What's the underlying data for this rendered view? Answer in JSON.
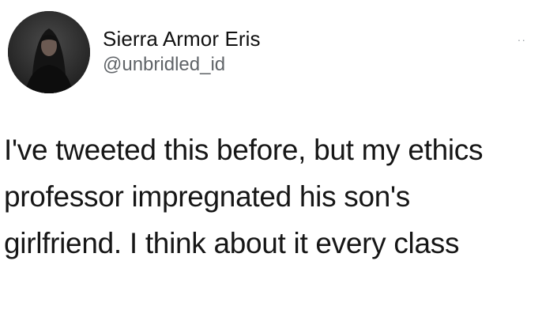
{
  "user": {
    "display_name": "Sierra Armor Eris",
    "handle": "@unbridled_id",
    "avatar": "profile-photo"
  },
  "menu_icon": "more-dots-icon",
  "menu_glyph": "··",
  "tweet": {
    "text": "I've tweeted this before, but my ethics professor impregnated his son's girlfriend. I think about it every class"
  },
  "colors": {
    "background": "#ffffff",
    "text": "#161616",
    "handle": "#606468"
  }
}
